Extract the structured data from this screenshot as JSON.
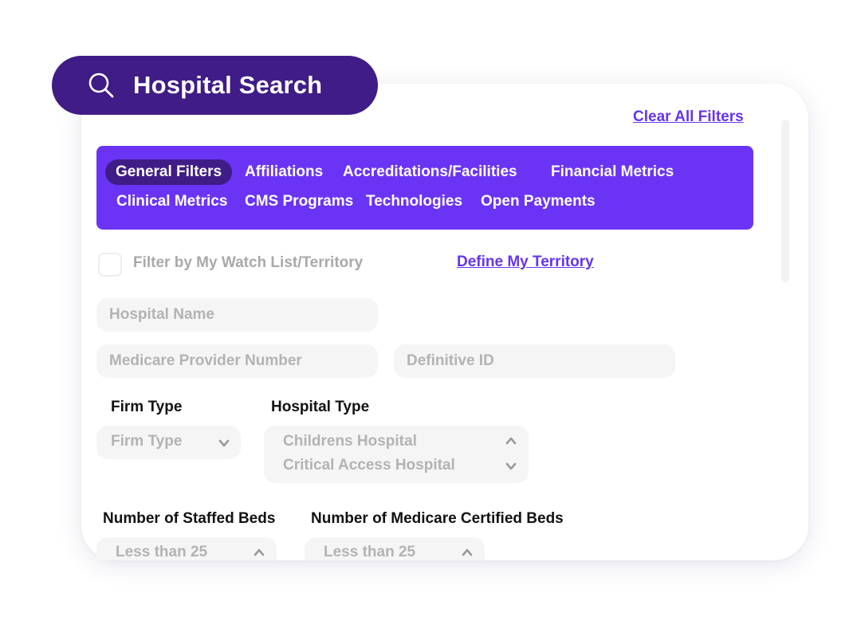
{
  "header": {
    "title": "Hospital Search",
    "icon": "search-icon"
  },
  "actions": {
    "clear_filters": "Clear All Filters",
    "define_territory": "Define My Territory"
  },
  "tabs": [
    {
      "label": "General Filters",
      "active": true
    },
    {
      "label": "Affiliations",
      "active": false
    },
    {
      "label": "Accreditations/Facilities",
      "active": false
    },
    {
      "label": "Financial Metrics",
      "active": false
    },
    {
      "label": "Clinical Metrics",
      "active": false
    },
    {
      "label": "CMS Programs",
      "active": false
    },
    {
      "label": "Technologies",
      "active": false
    },
    {
      "label": "Open Payments",
      "active": false
    }
  ],
  "watchlist": {
    "label": "Filter by My Watch List/Territory",
    "checked": false
  },
  "inputs": {
    "hospital_name_placeholder": "Hospital Name",
    "medicare_provider_placeholder": "Medicare Provider Number",
    "definitive_id_placeholder": "Definitive ID"
  },
  "firm_type": {
    "label": "Firm Type",
    "placeholder": "Firm Type"
  },
  "hospital_type": {
    "label": "Hospital Type",
    "options": [
      "Childrens Hospital",
      "Critical Access Hospital"
    ]
  },
  "staffed_beds": {
    "label": "Number of Staffed Beds",
    "value": "Less than 25"
  },
  "medicare_beds": {
    "label": "Number of Medicare Certified Beds",
    "value": "Less than 25"
  },
  "colors": {
    "accent_purple": "#6b34f5",
    "dark_purple": "#3f1c86",
    "link": "#6634f0",
    "placeholder": "#b3b3b3",
    "field_bg": "#f5f5f5"
  }
}
